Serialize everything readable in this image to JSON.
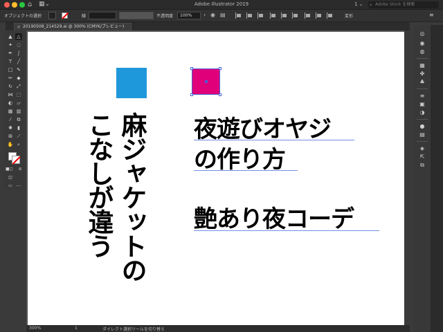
{
  "app": {
    "title": "Adobe Illustrator 2019",
    "page_indicator": "1 ⌄",
    "search_placeholder": "Adobe Stock を検索"
  },
  "control_bar": {
    "selection_label": "オブジェクトの選択",
    "stroke_label": "線",
    "opacity_label": "不透明度",
    "opacity_value": "100%",
    "transform_label": "変形"
  },
  "document_tab": {
    "label": "20190508_214529.ai @ 300% (CMYK/プレビュー)",
    "close": "×"
  },
  "canvas": {
    "vertical_lines": [
      "麻ジャケットの",
      "こなしが違う"
    ],
    "horizontal_lines": [
      "夜遊びオヤジ",
      "の作り方",
      "艶あり夜コーデ"
    ]
  },
  "status_bar": {
    "zoom": "300%",
    "page": "1",
    "current_tool": "ダイレクト選択ツールを切り替え"
  },
  "colors": {
    "blue_square": "#1f98db",
    "pink_square": "#e0007a",
    "selection": "#4a5fd6"
  }
}
